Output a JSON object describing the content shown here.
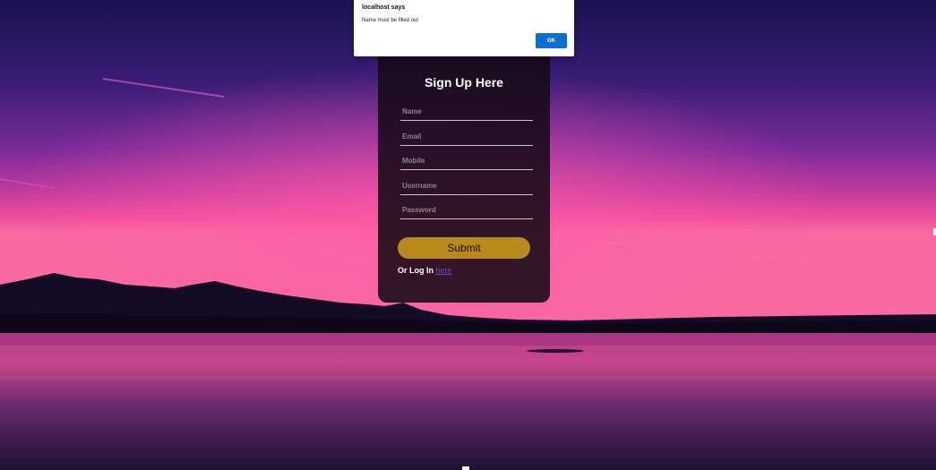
{
  "alert": {
    "title": "localhost says",
    "message": "Name must be filled out",
    "ok_label": "OK"
  },
  "form": {
    "title": "Sign Up Here",
    "fields": [
      {
        "name": "name",
        "placeholder": "Name",
        "value": ""
      },
      {
        "name": "email",
        "placeholder": "Email",
        "value": ""
      },
      {
        "name": "mobile",
        "placeholder": "Mobile",
        "value": ""
      },
      {
        "name": "username",
        "placeholder": "Username",
        "value": ""
      },
      {
        "name": "password",
        "placeholder": "Password",
        "value": ""
      }
    ],
    "submit_label": "Submit",
    "login_prefix": "Or Log In",
    "login_link_label": "here"
  },
  "colors": {
    "submit_button": "#b8891b",
    "alert_ok_button": "#0b6fcf",
    "login_link": "#7b3fd6",
    "card_background": "#160a16"
  }
}
